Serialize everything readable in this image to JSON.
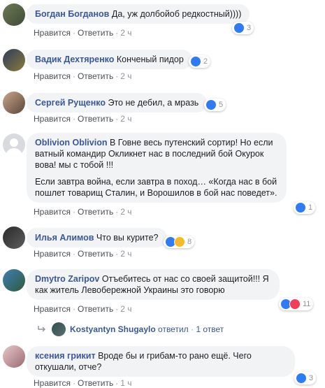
{
  "comments": [
    {
      "author": "Богдан Богданов",
      "text": "Да, уж долбойоб редкостный))))",
      "reply": "Ответить",
      "like": "Нравится",
      "time": "2 ч",
      "reactions": "3"
    },
    {
      "author": "Вадик Дехтяренко",
      "text": "Конченый пидор",
      "reply": "Ответить",
      "like": "Нравится",
      "time": "2 ч",
      "reactions": "2"
    },
    {
      "author": "Сергей Рущенко",
      "text": "Это не дебил, а мразь",
      "reply": "Ответить",
      "like": "Нравится",
      "time": "2 ч",
      "reactions": "5"
    },
    {
      "author": "Oblivion Oblivion",
      "text": "В Говне весь путенский сортир! Но если ватный командир Окликнет нас в последний бой Окурок вова! мы с тобой !!!",
      "text2": "Если завтра война, если завтра в поход… «Когда нас в бой пошлет товарищ Сталин, и Ворошилов в бой нас поведет».",
      "reply": "Ответить",
      "like": "Нравится",
      "time": "2 ч",
      "reactions": "1"
    },
    {
      "author": "Илья Алимов",
      "text": "Что вы курите?",
      "reply": "Ответить",
      "like": "Нравится",
      "time": "2 ч",
      "reactions": "8"
    },
    {
      "author": "Dmytro Zaripov",
      "text": "Отъебитесь от нас со своей защитой!!! Я как житель Левобережной Украины это говорю",
      "reply": "Ответить",
      "like": "Нравится",
      "time": "2 ч",
      "reactions": "11"
    },
    {
      "author": "ксения грикит",
      "text": "Вроде бы и грибам-то рано ещё. Чего откушали, отче?",
      "reply": "Ответить",
      "like": "Нравится",
      "time": "1 ч",
      "reactions": "3"
    }
  ],
  "reply_summary": {
    "author": "Kostyantyn Shugaylo",
    "verb": "ответил",
    "dot": "·",
    "count": "1 ответ"
  },
  "colors": {
    "link": "#385898",
    "bubble": "#f2f3f5",
    "meta": "#90949c",
    "like": "#2e7bf6"
  }
}
